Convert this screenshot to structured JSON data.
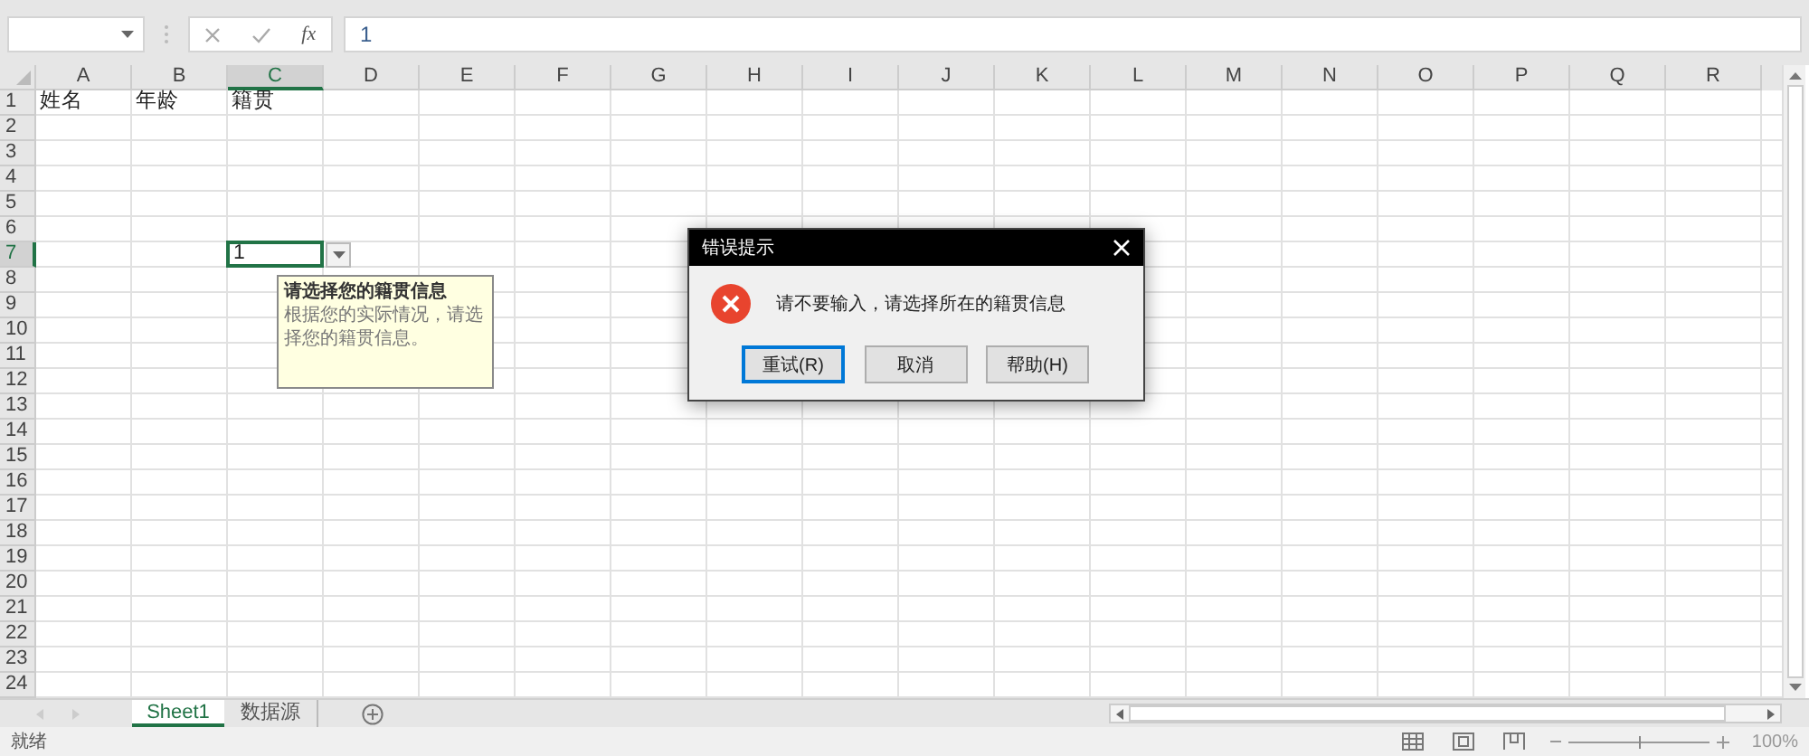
{
  "formula_bar": {
    "function_label": "fx",
    "value": "1"
  },
  "columns": [
    {
      "label": "A",
      "selected": false
    },
    {
      "label": "B",
      "selected": false
    },
    {
      "label": "C",
      "selected": true
    },
    {
      "label": "D",
      "selected": false
    },
    {
      "label": "E",
      "selected": false
    },
    {
      "label": "F",
      "selected": false
    },
    {
      "label": "G",
      "selected": false
    },
    {
      "label": "H",
      "selected": false
    },
    {
      "label": "I",
      "selected": false
    },
    {
      "label": "J",
      "selected": false
    },
    {
      "label": "K",
      "selected": false
    },
    {
      "label": "L",
      "selected": false
    },
    {
      "label": "M",
      "selected": false
    },
    {
      "label": "N",
      "selected": false
    },
    {
      "label": "O",
      "selected": false
    },
    {
      "label": "P",
      "selected": false
    },
    {
      "label": "Q",
      "selected": false
    },
    {
      "label": "R",
      "selected": false
    }
  ],
  "rows": [
    {
      "label": "1",
      "selected": false,
      "cells": {
        "A": {
          "text": "姓名",
          "selected": false
        },
        "B": {
          "text": "年龄",
          "selected": false
        },
        "C": {
          "text": "籍贯",
          "selected": false
        }
      }
    },
    {
      "label": "2",
      "selected": false
    },
    {
      "label": "3",
      "selected": false
    },
    {
      "label": "4",
      "selected": false
    },
    {
      "label": "5",
      "selected": false
    },
    {
      "label": "6",
      "selected": false
    },
    {
      "label": "7",
      "selected": true,
      "cells": {
        "C": {
          "text": "1",
          "selected": true,
          "has_dropdown": true
        }
      }
    },
    {
      "label": "8",
      "selected": false
    },
    {
      "label": "9",
      "selected": false
    },
    {
      "label": "10",
      "selected": false
    },
    {
      "label": "11",
      "selected": false
    },
    {
      "label": "12",
      "selected": false
    },
    {
      "label": "13",
      "selected": false
    },
    {
      "label": "14",
      "selected": false
    },
    {
      "label": "15",
      "selected": false
    },
    {
      "label": "16",
      "selected": false
    },
    {
      "label": "17",
      "selected": false
    },
    {
      "label": "18",
      "selected": false
    },
    {
      "label": "19",
      "selected": false
    },
    {
      "label": "20",
      "selected": false
    },
    {
      "label": "21",
      "selected": false
    },
    {
      "label": "22",
      "selected": false
    },
    {
      "label": "23",
      "selected": false
    },
    {
      "label": "24",
      "selected": false
    }
  ],
  "input_message": {
    "title": "请选择您的籍贯信息",
    "text": "根据您的实际情况，请选择您的籍贯信息。"
  },
  "dialog": {
    "title": "错误提示",
    "message": "请不要输入，请选择所在的籍贯信息",
    "buttons": [
      {
        "label": "重试(R)",
        "selected": true
      },
      {
        "label": "取消",
        "selected": false
      },
      {
        "label": "帮助(H)",
        "selected": false
      }
    ]
  },
  "sheet_tabs": [
    {
      "label": "Sheet1",
      "selected": true
    },
    {
      "label": "数据源",
      "selected": false
    }
  ],
  "status_bar": {
    "status": "就绪",
    "zoom": "100%",
    "zoom_level": {
      "level": 0.5
    }
  }
}
